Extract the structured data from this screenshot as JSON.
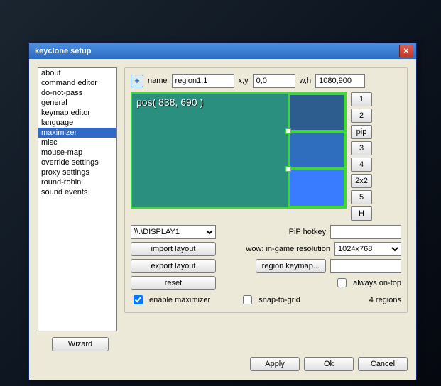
{
  "window": {
    "title": "keyclone setup"
  },
  "sidebar": {
    "items": [
      {
        "label": "about"
      },
      {
        "label": "command editor"
      },
      {
        "label": "do-not-pass"
      },
      {
        "label": "general"
      },
      {
        "label": "keymap editor"
      },
      {
        "label": "language"
      },
      {
        "label": "maximizer",
        "selected": true
      },
      {
        "label": "misc"
      },
      {
        "label": "mouse-map"
      },
      {
        "label": "override settings"
      },
      {
        "label": "proxy settings"
      },
      {
        "label": "round-robin"
      },
      {
        "label": "sound events"
      }
    ]
  },
  "maximizer": {
    "add_icon": "+",
    "name_label": "name",
    "name_value": "region1.1",
    "xy_label": "x,y",
    "xy_value": "0,0",
    "wh_label": "w,h",
    "wh_value": "1080,900",
    "pos_text": "pos( 838, 690 )",
    "side_buttons": [
      "1",
      "2",
      "pip",
      "3",
      "4",
      "2x2",
      "5",
      "H"
    ],
    "display_value": "\\\\.\\DISPLAY1",
    "import_label": "import layout",
    "export_label": "export layout",
    "reset_label": "reset",
    "pip_hotkey_label": "PiP hotkey",
    "pip_hotkey_value": "",
    "resolution_label": "wow: in-game resolution",
    "resolution_value": "1024x768",
    "region_keymap_label": "region keymap...",
    "region_keymap_value": "",
    "always_on_top_label": "always on-top",
    "enable_label": "enable maximizer",
    "snap_label": "snap-to-grid",
    "regions_count": "4 regions"
  },
  "footer": {
    "wizard": "Wizard",
    "apply": "Apply",
    "ok": "Ok",
    "cancel": "Cancel"
  }
}
